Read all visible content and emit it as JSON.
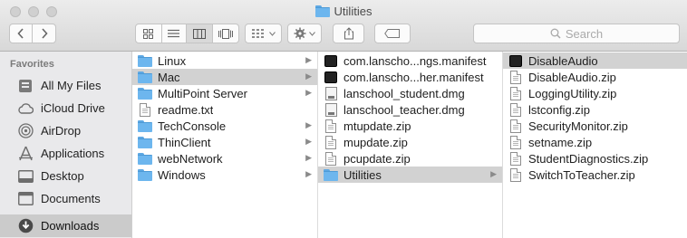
{
  "window": {
    "title": "Utilities"
  },
  "toolbar": {
    "back_icon": "chevron-left-icon",
    "forward_icon": "chevron-right-icon",
    "view_modes": [
      "icon-view-icon",
      "list-view-icon",
      "column-view-icon",
      "cover-flow-view-icon"
    ],
    "active_view": "column-view-icon",
    "arrange_icon": "arrange-grid-icon",
    "action_icon": "gear-icon",
    "share_icon": "share-icon",
    "tags_icon": "tag-icon",
    "search_placeholder": "Search"
  },
  "sidebar": {
    "heading": "Favorites",
    "items": [
      {
        "label": "All My Files",
        "icon": "all-files-icon"
      },
      {
        "label": "iCloud Drive",
        "icon": "cloud-icon"
      },
      {
        "label": "AirDrop",
        "icon": "airdrop-icon"
      },
      {
        "label": "Applications",
        "icon": "applications-icon"
      },
      {
        "label": "Desktop",
        "icon": "desktop-icon"
      },
      {
        "label": "Documents",
        "icon": "documents-icon"
      },
      {
        "label": "Downloads",
        "icon": "downloads-icon",
        "selected": true
      }
    ]
  },
  "columns": [
    {
      "items": [
        {
          "name": "Linux",
          "kind": "folder",
          "arrow": true
        },
        {
          "name": "Mac",
          "kind": "folder",
          "arrow": true,
          "selected": true
        },
        {
          "name": "MultiPoint Server",
          "kind": "folder",
          "arrow": true
        },
        {
          "name": "readme.txt",
          "kind": "doc"
        },
        {
          "name": "TechConsole",
          "kind": "folder",
          "arrow": true
        },
        {
          "name": "ThinClient",
          "kind": "folder",
          "arrow": true
        },
        {
          "name": "webNetwork",
          "kind": "folder",
          "arrow": true
        },
        {
          "name": "Windows",
          "kind": "folder",
          "arrow": true
        }
      ]
    },
    {
      "items": [
        {
          "name": "com.lanscho...ngs.manifest",
          "kind": "black"
        },
        {
          "name": "com.lanscho...her.manifest",
          "kind": "black"
        },
        {
          "name": "lanschool_student.dmg",
          "kind": "dmg"
        },
        {
          "name": "lanschool_teacher.dmg",
          "kind": "dmg"
        },
        {
          "name": "mtupdate.zip",
          "kind": "doc"
        },
        {
          "name": "mupdate.zip",
          "kind": "doc"
        },
        {
          "name": "pcupdate.zip",
          "kind": "doc"
        },
        {
          "name": "Utilities",
          "kind": "folder",
          "arrow": true,
          "selected": true
        }
      ]
    },
    {
      "items": [
        {
          "name": "DisableAudio",
          "kind": "black",
          "selected": true
        },
        {
          "name": "DisableAudio.zip",
          "kind": "doc"
        },
        {
          "name": "LoggingUtility.zip",
          "kind": "doc"
        },
        {
          "name": "lstconfig.zip",
          "kind": "doc"
        },
        {
          "name": "SecurityMonitor.zip",
          "kind": "doc"
        },
        {
          "name": "setname.zip",
          "kind": "doc"
        },
        {
          "name": "StudentDiagnostics.zip",
          "kind": "doc"
        },
        {
          "name": "SwitchToTeacher.zip",
          "kind": "doc"
        }
      ]
    }
  ],
  "colors": {
    "folder_blue": "#6db6ee",
    "selection_gray": "#d2d2d2",
    "sidebar_bg": "#e9e9eb"
  }
}
